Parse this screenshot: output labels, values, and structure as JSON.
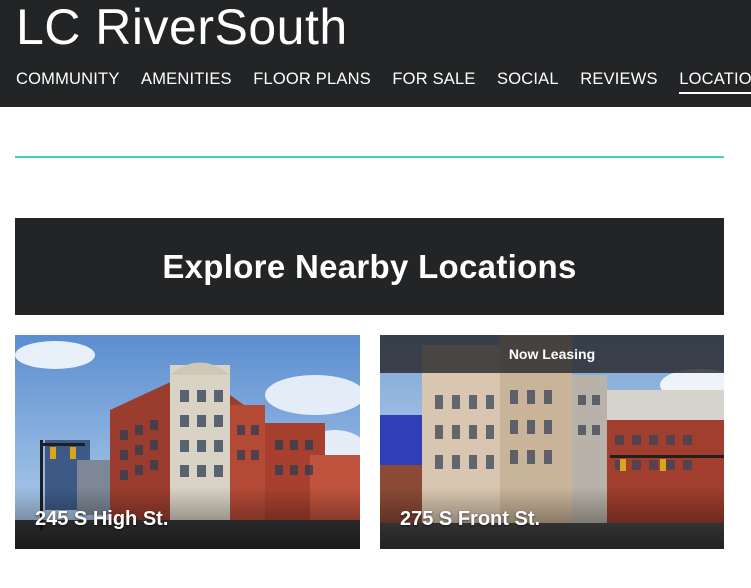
{
  "site": {
    "title": "LC RiverSouth"
  },
  "nav": {
    "items": [
      {
        "label": "COMMUNITY",
        "active": false
      },
      {
        "label": "AMENITIES",
        "active": false
      },
      {
        "label": "FLOOR PLANS",
        "active": false
      },
      {
        "label": "FOR SALE",
        "active": false
      },
      {
        "label": "SOCIAL",
        "active": false
      },
      {
        "label": "REVIEWS",
        "active": false
      },
      {
        "label": "LOCATION",
        "active": true
      }
    ]
  },
  "colors": {
    "header_bg": "#232426",
    "accent_divider": "#3fd3b8"
  },
  "banner": {
    "title": "Explore Nearby Locations"
  },
  "locations": [
    {
      "name": "245 S High St.",
      "badge": ""
    },
    {
      "name": "275 S Front St.",
      "badge": "Now Leasing"
    }
  ]
}
